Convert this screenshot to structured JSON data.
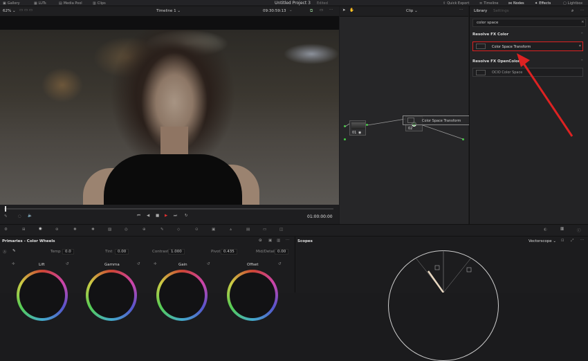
{
  "topbar": {
    "left": [
      "Gallery",
      "LUTs",
      "Media Pool",
      "Clips"
    ],
    "project_title": "Untitled Project 3",
    "project_status": "Edited",
    "right": [
      "Quick Export",
      "Timeline",
      "Nodes",
      "Effects",
      "Lightbox"
    ]
  },
  "viewer": {
    "zoom": "62%",
    "timeline_name": "Timeline 1",
    "timecode_top": "09:30:59:13",
    "timecode_bottom": "01:00:00:00"
  },
  "nodes": {
    "mode": "Clip",
    "node_label": "01",
    "node2_label": "02",
    "drag_label": "Color Space Transform"
  },
  "library": {
    "tab_library": "Library",
    "tab_settings": "Settings",
    "search_value": "color space",
    "section1": "Resolve FX Color",
    "item1": "Color Space Transform",
    "section2": "Resolve FX OpenColorIO",
    "item2": "OCIO Color Space"
  },
  "primaries": {
    "title": "Primaries - Color Wheels",
    "temp_label": "Temp",
    "temp_value": "0.0",
    "tint_label": "Tint",
    "tint_value": "0.00",
    "contrast_label": "Contrast",
    "contrast_value": "1.000",
    "pivot_label": "Pivot",
    "pivot_value": "0.435",
    "middetail_label": "Mid/Detail",
    "middetail_value": "0.00",
    "wheels": [
      "Lift",
      "Gamma",
      "Gain",
      "Offset"
    ]
  },
  "scopes": {
    "title": "Scopes",
    "type": "Vectorscope"
  },
  "colors": {
    "accent_red": "#dd2222",
    "node_green": "#44cc44",
    "playhead_red": "#e03030"
  }
}
